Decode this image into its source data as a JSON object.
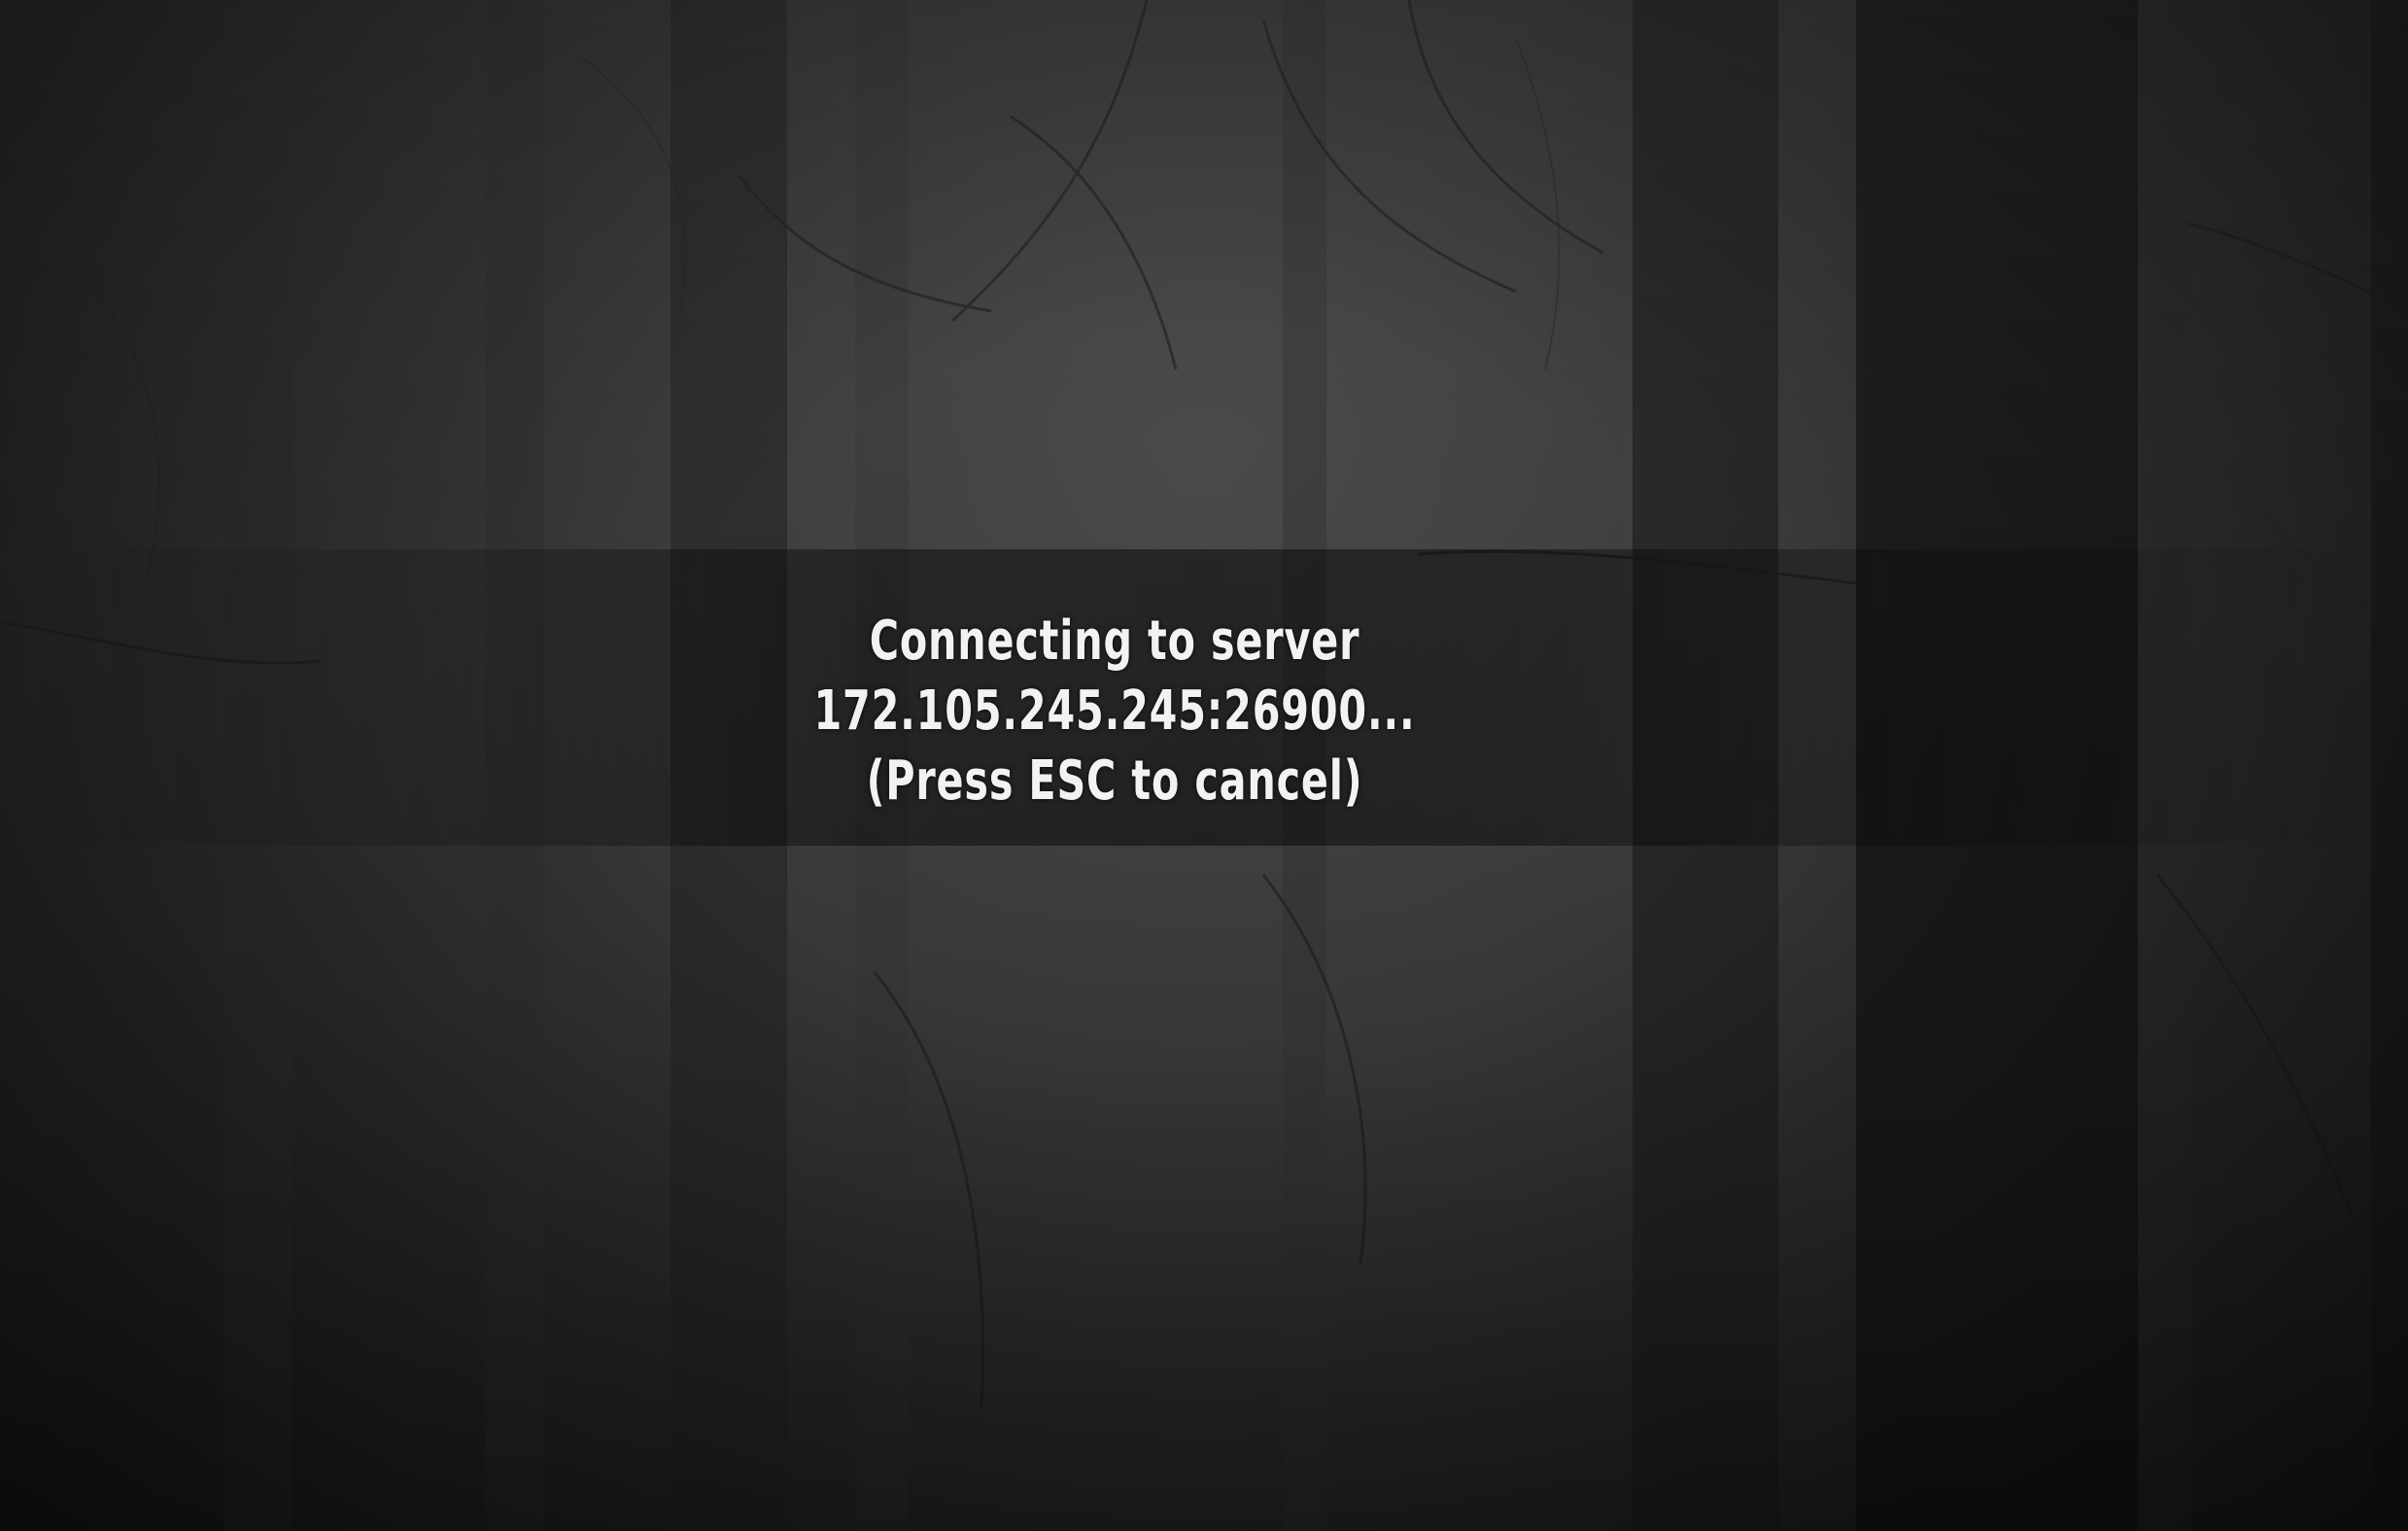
{
  "connecting": {
    "line1": "Connecting to server",
    "line2": "172.105.245.245:26900...",
    "line3": "(Press ESC to cancel)"
  },
  "colors": {
    "text": "#f2f2f2",
    "background": "#2a2a2a"
  }
}
